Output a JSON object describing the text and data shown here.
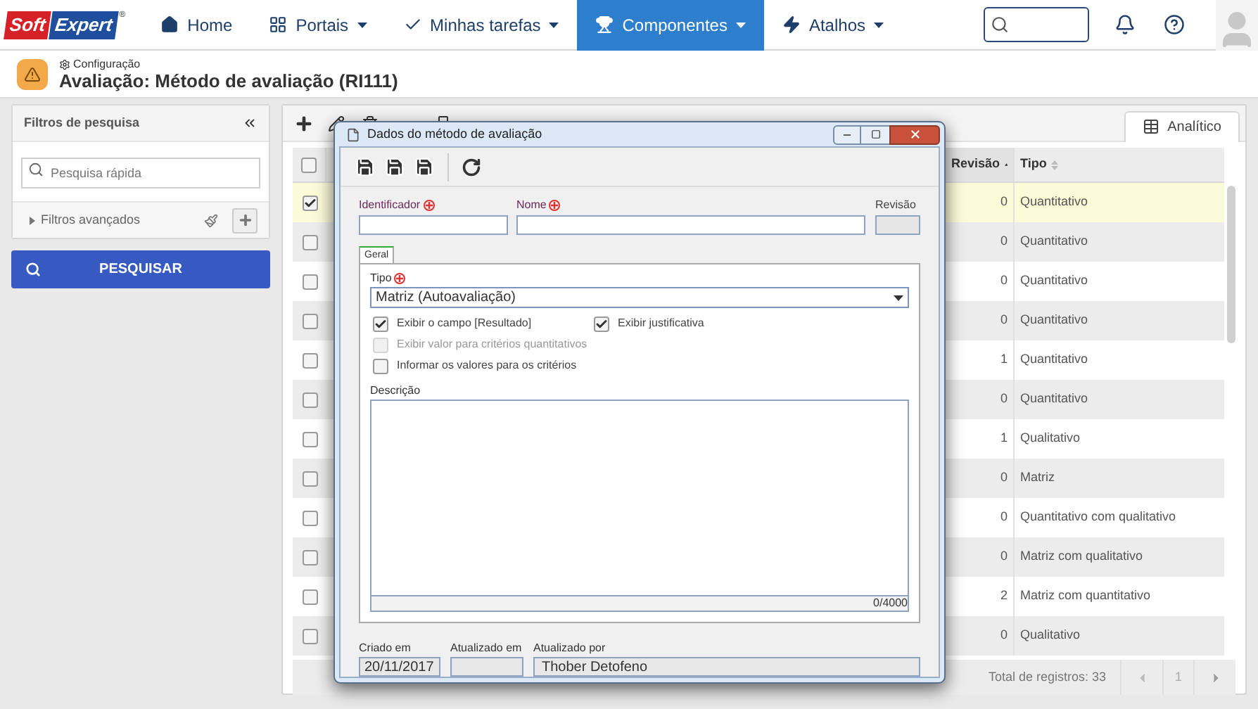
{
  "logo": {
    "parts": [
      "Soft",
      "Expert"
    ],
    "mark": "®"
  },
  "nav": [
    {
      "label": "Home",
      "dropdown": false,
      "selected": false
    },
    {
      "label": "Portais",
      "dropdown": true,
      "selected": false
    },
    {
      "label": "Minhas tarefas",
      "dropdown": true,
      "selected": false
    },
    {
      "label": "Componentes",
      "dropdown": true,
      "selected": true
    },
    {
      "label": "Atalhos",
      "dropdown": true,
      "selected": false
    }
  ],
  "header": {
    "breadcrumb": "Configuração",
    "title": "Avaliação: Método de avaliação (RI111)"
  },
  "filters": {
    "title": "Filtros de pesquisa",
    "search_placeholder": "Pesquisa rápida",
    "advanced": "Filtros avançados",
    "button": "PESQUISAR"
  },
  "toolbar": {
    "view_tab": "Analítico"
  },
  "table": {
    "all_checked": false,
    "columns": [
      {
        "label": "Revisão",
        "sorted": true
      },
      {
        "label": "Tipo",
        "sorted": false
      }
    ],
    "rows": [
      {
        "checked": true,
        "selected": true,
        "revision": "0",
        "type": "Quantitativo"
      },
      {
        "checked": false,
        "selected": false,
        "revision": "0",
        "type": "Quantitativo"
      },
      {
        "checked": false,
        "selected": false,
        "revision": "0",
        "type": "Quantitativo"
      },
      {
        "checked": false,
        "selected": false,
        "revision": "0",
        "type": "Quantitativo"
      },
      {
        "checked": false,
        "selected": false,
        "revision": "1",
        "type": "Quantitativo"
      },
      {
        "checked": false,
        "selected": false,
        "revision": "0",
        "type": "Quantitativo"
      },
      {
        "checked": false,
        "selected": false,
        "revision": "1",
        "type": "Qualitativo"
      },
      {
        "checked": false,
        "selected": false,
        "revision": "0",
        "type": "Matriz"
      },
      {
        "checked": false,
        "selected": false,
        "revision": "0",
        "type": "Quantitativo com qualitativo"
      },
      {
        "checked": false,
        "selected": false,
        "revision": "0",
        "type": "Matriz com qualitativo"
      },
      {
        "checked": false,
        "selected": false,
        "revision": "2",
        "type": "Matriz com quantitativo"
      },
      {
        "checked": false,
        "selected": false,
        "revision": "0",
        "type": "Qualitativo"
      }
    ],
    "total": "Total de registros: 33",
    "page": "1"
  },
  "dialog": {
    "title": "Dados do método de avaliação",
    "identifier": {
      "label": "Identificador",
      "required": true
    },
    "name": {
      "label": "Nome",
      "required": true
    },
    "revision": {
      "label": "Revisão"
    },
    "tabs": [
      {
        "label": "Geral",
        "selected": true
      }
    ],
    "type": {
      "label": "Tipo",
      "required": true,
      "value": "Matriz (Autoavaliação)"
    },
    "checkboxes": [
      {
        "label": "Exibir o campo [Resultado]",
        "checked": true,
        "disabled": false
      },
      {
        "label": "Exibir justificativa",
        "checked": true,
        "disabled": false
      },
      {
        "label": "Exibir valor para critérios quantitativos",
        "checked": false,
        "disabled": true
      },
      {
        "label": "Informar os valores para os critérios",
        "checked": false,
        "disabled": false
      }
    ],
    "description": {
      "label": "Descrição",
      "counter": "0/4000"
    },
    "created": {
      "label": "Criado em",
      "value": "20/11/2017"
    },
    "updated": {
      "label": "Atualizado em"
    },
    "updated_by": {
      "label": "Atualizado por",
      "value": "Thober Detofeno"
    }
  }
}
